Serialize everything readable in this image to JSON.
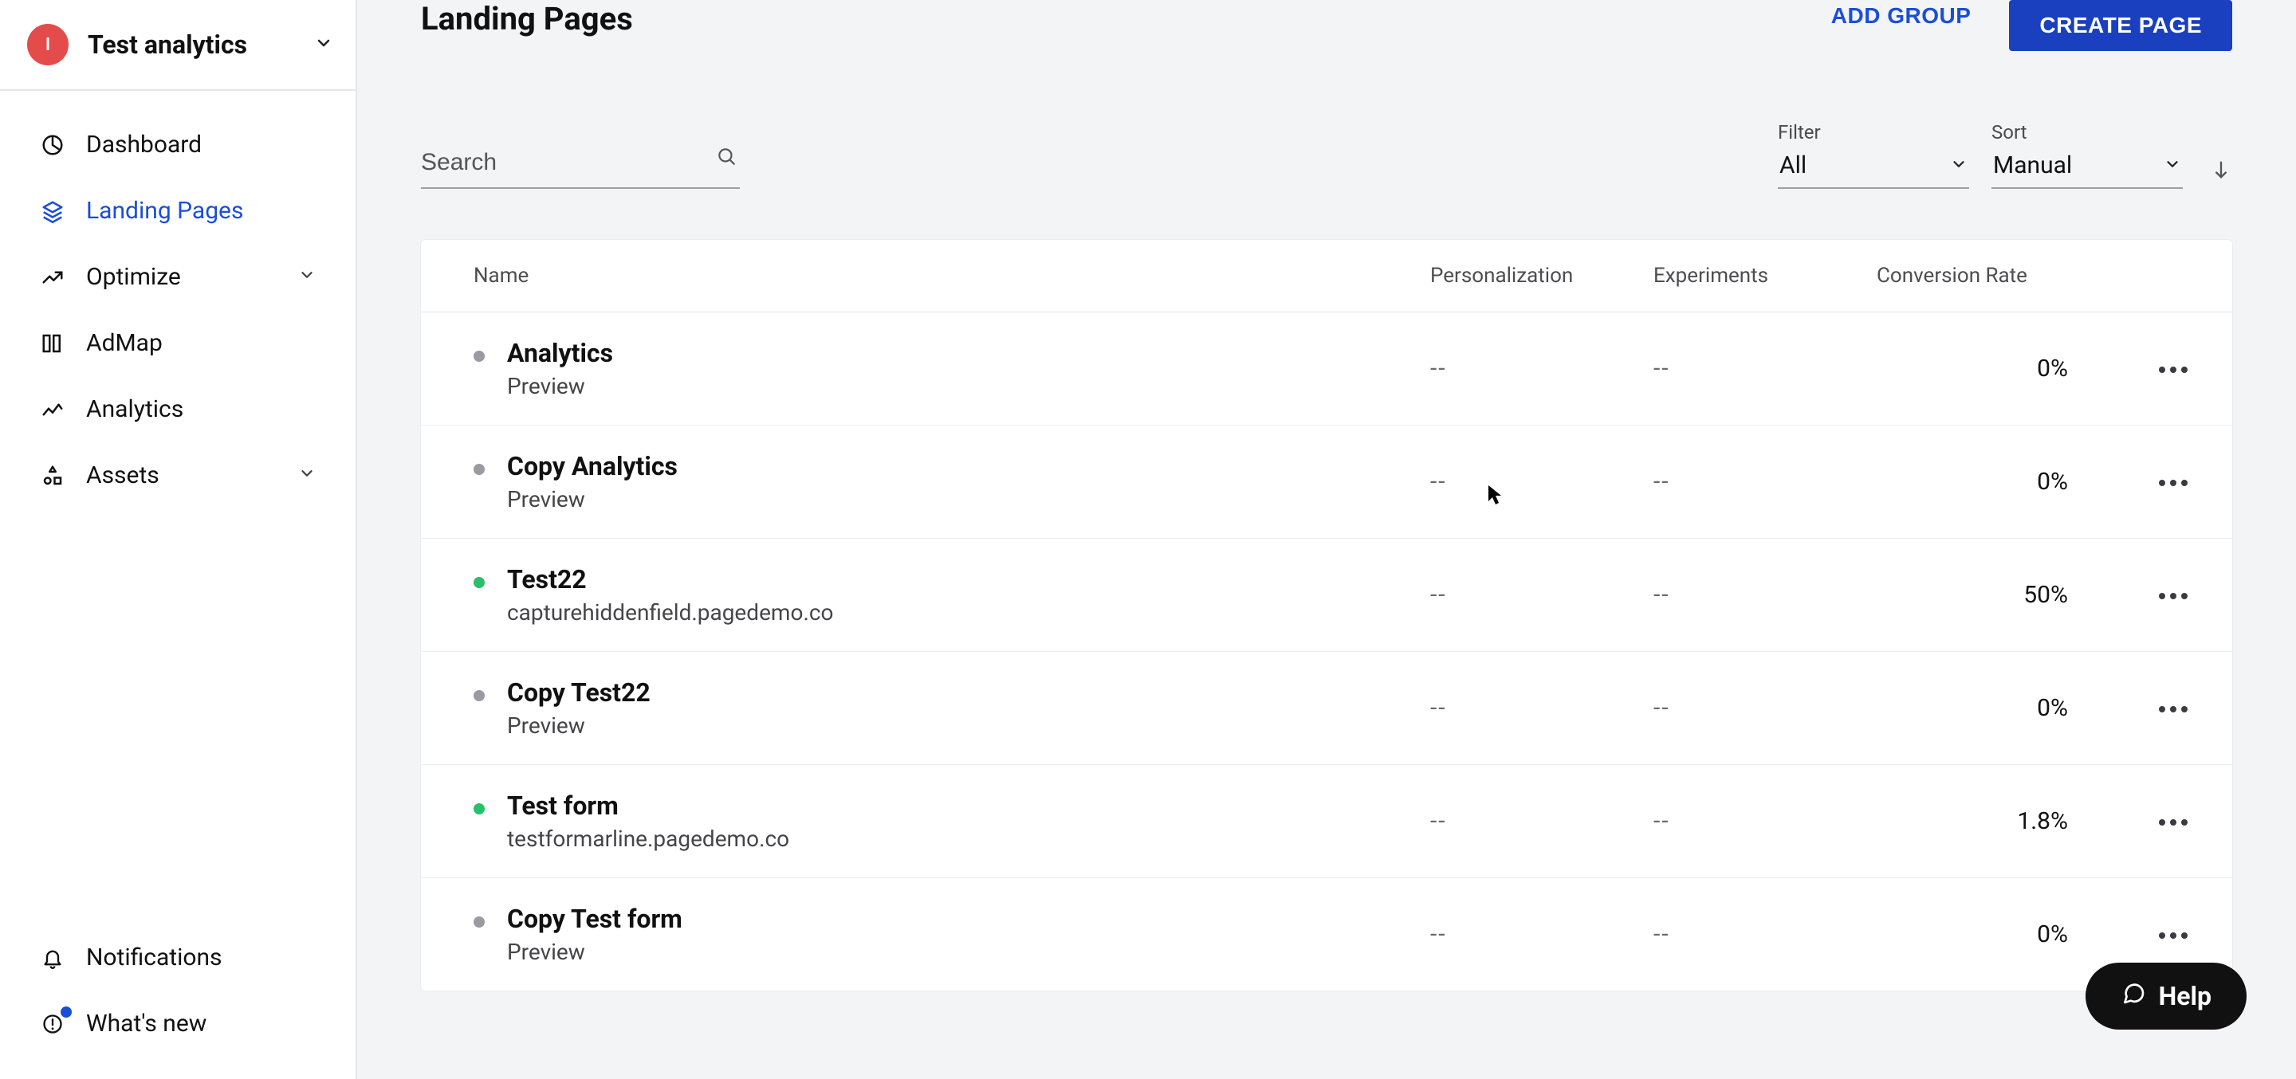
{
  "workspace": {
    "initial": "I",
    "name": "Test analytics"
  },
  "sidebar": {
    "items": [
      {
        "label": "Dashboard"
      },
      {
        "label": "Landing Pages"
      },
      {
        "label": "Optimize"
      },
      {
        "label": "AdMap"
      },
      {
        "label": "Analytics"
      },
      {
        "label": "Assets"
      }
    ],
    "bottom": [
      {
        "label": "Notifications"
      },
      {
        "label": "What's new"
      }
    ]
  },
  "header": {
    "title": "Landing Pages",
    "add_group": "ADD GROUP",
    "create_page": "CREATE PAGE"
  },
  "search": {
    "placeholder": "Search"
  },
  "filter": {
    "label": "Filter",
    "value": "All"
  },
  "sort": {
    "label": "Sort",
    "value": "Manual"
  },
  "table": {
    "columns": {
      "name": "Name",
      "personalization": "Personalization",
      "experiments": "Experiments",
      "conversion": "Conversion Rate"
    },
    "rows": [
      {
        "status": "off",
        "name": "Analytics",
        "sub": "Preview",
        "pers": "--",
        "exp": "--",
        "conv": "0%"
      },
      {
        "status": "off",
        "name": "Copy Analytics",
        "sub": "Preview",
        "pers": "--",
        "exp": "--",
        "conv": "0%"
      },
      {
        "status": "on",
        "name": "Test22",
        "sub": "capturehiddenfield.pagedemo.co",
        "pers": "--",
        "exp": "--",
        "conv": "50%"
      },
      {
        "status": "off",
        "name": "Copy Test22",
        "sub": "Preview",
        "pers": "--",
        "exp": "--",
        "conv": "0%"
      },
      {
        "status": "on",
        "name": "Test form",
        "sub": "testformarline.pagedemo.co",
        "pers": "--",
        "exp": "--",
        "conv": "1.8%"
      },
      {
        "status": "off",
        "name": "Copy Test form",
        "sub": "Preview",
        "pers": "--",
        "exp": "--",
        "conv": "0%"
      }
    ]
  },
  "help": {
    "label": "Help"
  }
}
